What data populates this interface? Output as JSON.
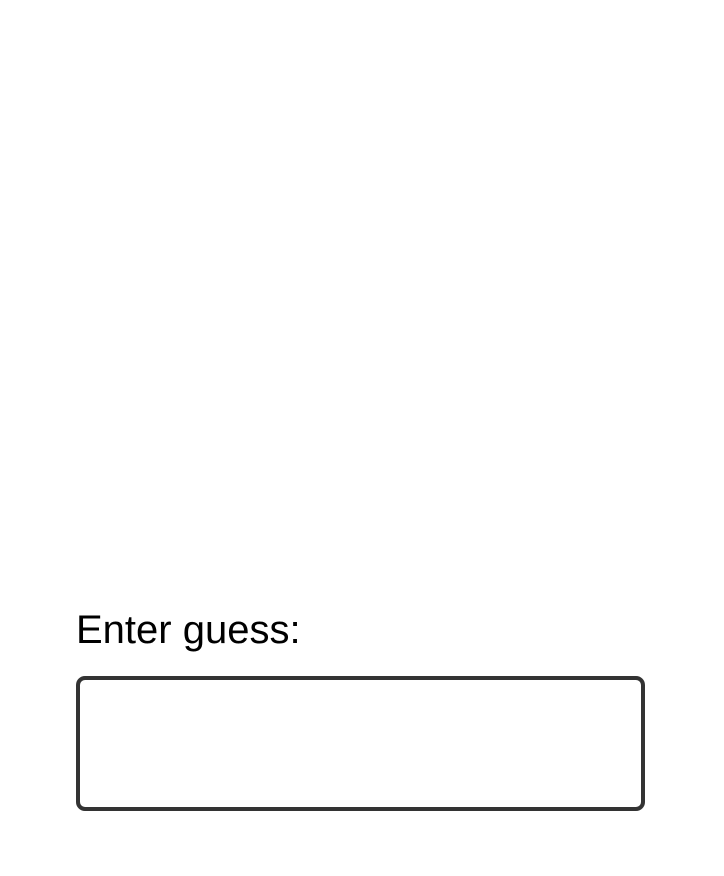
{
  "form": {
    "label": "Enter guess:",
    "input_value": "",
    "input_placeholder": ""
  }
}
